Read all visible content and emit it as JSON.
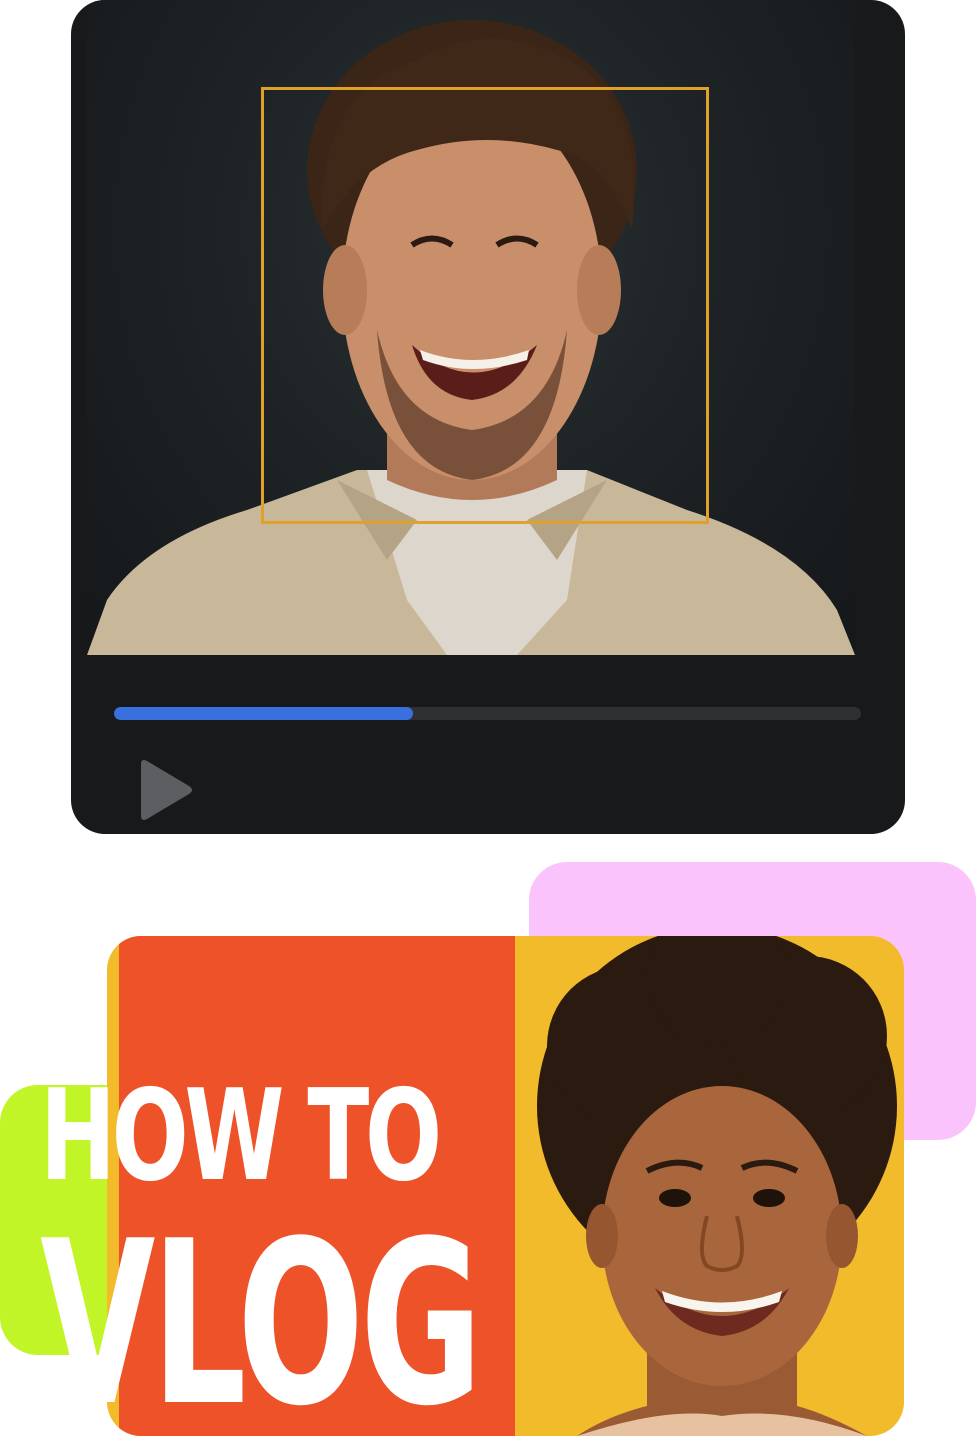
{
  "player": {
    "progress_fraction": 0.4,
    "accent_color": "#3a6fe0",
    "face_box_color": "#e0a12a",
    "play_icon": "play-icon"
  },
  "thumbnail": {
    "headline_line1": "HOW TO",
    "headline_line2": "VLOG",
    "left_color": "#ee5229",
    "right_color": "#f1bb2c",
    "accent_pink": "#fbc3fb",
    "accent_lime": "#c2f527"
  }
}
